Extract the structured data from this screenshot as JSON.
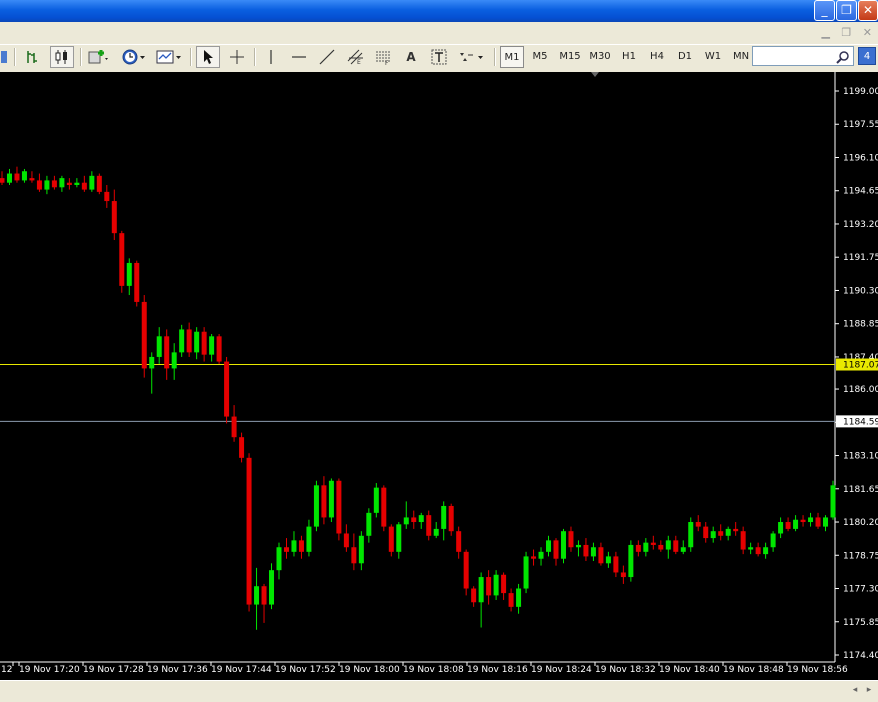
{
  "window": {
    "minimize_label": "_",
    "restore_label": "❐",
    "close_label": "✕"
  },
  "toolbar": {
    "timeframes": [
      {
        "label": "M1",
        "active": true
      },
      {
        "label": "M5",
        "active": false
      },
      {
        "label": "M15",
        "active": false
      },
      {
        "label": "M30",
        "active": false
      },
      {
        "label": "H1",
        "active": false
      },
      {
        "label": "H4",
        "active": false
      },
      {
        "label": "D1",
        "active": false
      },
      {
        "label": "W1",
        "active": false
      },
      {
        "label": "MN",
        "active": false
      }
    ],
    "text_tool_label": "A",
    "search_placeholder": "",
    "tabs_count_badge": "4"
  },
  "colors": {
    "background": "#000000",
    "bull": "#00E600",
    "bear": "#E60000",
    "price_line": "#E8E800",
    "level_line": "#8C9BAF"
  },
  "chart_data": {
    "type": "candlestick",
    "price_axis": {
      "ticks": [
        1199.0,
        1197.55,
        1196.1,
        1194.65,
        1193.2,
        1191.75,
        1190.3,
        1188.85,
        1187.4,
        1186.0,
        1184.55,
        1183.1,
        1181.65,
        1180.2,
        1178.75,
        1177.3,
        1175.85,
        1174.4
      ],
      "current_price": "1187.07",
      "level_label": "1184.59"
    },
    "time_axis": [
      "12",
      "19 Nov 17:20",
      "19 Nov 17:28",
      "19 Nov 17:36",
      "19 Nov 17:44",
      "19 Nov 17:52",
      "19 Nov 18:00",
      "19 Nov 18:08",
      "19 Nov 18:16",
      "19 Nov 18:24",
      "19 Nov 18:32",
      "19 Nov 18:40",
      "19 Nov 18:48",
      "19 Nov 18:56"
    ],
    "candles_ohlc": [
      [
        1195.2,
        1195.5,
        1194.9,
        1195.0
      ],
      [
        1195.0,
        1195.6,
        1194.9,
        1195.4
      ],
      [
        1195.4,
        1195.7,
        1195.0,
        1195.1
      ],
      [
        1195.1,
        1195.6,
        1195.0,
        1195.5
      ],
      [
        1195.2,
        1195.5,
        1195.0,
        1195.1
      ],
      [
        1195.1,
        1195.4,
        1194.6,
        1194.7
      ],
      [
        1194.7,
        1195.3,
        1194.5,
        1195.1
      ],
      [
        1195.1,
        1195.3,
        1194.7,
        1194.8
      ],
      [
        1194.8,
        1195.3,
        1194.6,
        1195.2
      ],
      [
        1195.0,
        1195.2,
        1194.7,
        1194.9
      ],
      [
        1194.9,
        1195.2,
        1194.8,
        1195.0
      ],
      [
        1195.0,
        1195.3,
        1194.6,
        1194.7
      ],
      [
        1194.7,
        1195.5,
        1194.6,
        1195.3
      ],
      [
        1195.3,
        1195.4,
        1194.5,
        1194.6
      ],
      [
        1194.6,
        1194.9,
        1193.9,
        1194.2
      ],
      [
        1194.2,
        1194.7,
        1192.5,
        1192.8
      ],
      [
        1192.8,
        1192.9,
        1190.2,
        1190.5
      ],
      [
        1190.5,
        1191.7,
        1190.1,
        1191.5
      ],
      [
        1191.5,
        1191.6,
        1189.6,
        1189.8
      ],
      [
        1189.8,
        1190.1,
        1186.5,
        1186.9
      ],
      [
        1186.9,
        1187.6,
        1185.8,
        1187.4
      ],
      [
        1187.4,
        1188.7,
        1187.1,
        1188.3
      ],
      [
        1188.3,
        1188.6,
        1186.4,
        1186.9
      ],
      [
        1186.9,
        1188.0,
        1186.4,
        1187.6
      ],
      [
        1187.6,
        1188.8,
        1187.4,
        1188.6
      ],
      [
        1188.6,
        1188.9,
        1187.4,
        1187.6
      ],
      [
        1187.6,
        1188.7,
        1187.3,
        1188.5
      ],
      [
        1188.5,
        1188.7,
        1187.2,
        1187.5
      ],
      [
        1187.5,
        1188.4,
        1187.2,
        1188.3
      ],
      [
        1188.3,
        1188.4,
        1187.1,
        1187.2
      ],
      [
        1187.2,
        1187.4,
        1184.5,
        1184.8
      ],
      [
        1184.8,
        1185.3,
        1183.7,
        1183.9
      ],
      [
        1183.9,
        1184.1,
        1182.8,
        1183.0
      ],
      [
        1183.0,
        1183.2,
        1176.3,
        1176.6
      ],
      [
        1176.6,
        1178.2,
        1175.5,
        1177.4
      ],
      [
        1177.4,
        1177.5,
        1175.8,
        1176.6
      ],
      [
        1176.6,
        1178.4,
        1176.4,
        1178.1
      ],
      [
        1178.1,
        1179.3,
        1177.7,
        1179.1
      ],
      [
        1179.1,
        1179.5,
        1178.6,
        1178.9
      ],
      [
        1178.9,
        1179.8,
        1178.7,
        1179.4
      ],
      [
        1179.4,
        1179.6,
        1178.6,
        1178.9
      ],
      [
        1178.9,
        1180.3,
        1178.7,
        1180.0
      ],
      [
        1180.0,
        1182.0,
        1179.8,
        1181.8
      ],
      [
        1181.8,
        1182.2,
        1180.1,
        1180.4
      ],
      [
        1180.4,
        1182.1,
        1180.2,
        1182.0
      ],
      [
        1182.0,
        1182.1,
        1179.4,
        1179.7
      ],
      [
        1179.7,
        1180.1,
        1178.9,
        1179.1
      ],
      [
        1179.1,
        1179.7,
        1178.1,
        1178.4
      ],
      [
        1178.4,
        1179.8,
        1178.1,
        1179.6
      ],
      [
        1179.6,
        1180.8,
        1179.3,
        1180.6
      ],
      [
        1180.6,
        1181.9,
        1180.4,
        1181.7
      ],
      [
        1181.7,
        1181.8,
        1179.8,
        1180.0
      ],
      [
        1180.0,
        1180.1,
        1178.7,
        1178.9
      ],
      [
        1178.9,
        1180.2,
        1178.6,
        1180.1
      ],
      [
        1180.1,
        1181.1,
        1179.9,
        1180.4
      ],
      [
        1180.4,
        1180.7,
        1179.9,
        1180.2
      ],
      [
        1180.2,
        1180.6,
        1179.9,
        1180.5
      ],
      [
        1180.5,
        1180.7,
        1179.4,
        1179.6
      ],
      [
        1179.6,
        1180.2,
        1179.5,
        1179.9
      ],
      [
        1179.9,
        1181.1,
        1179.4,
        1180.9
      ],
      [
        1180.9,
        1181.0,
        1179.6,
        1179.8
      ],
      [
        1179.8,
        1180.0,
        1178.6,
        1178.9
      ],
      [
        1178.9,
        1179.0,
        1177.0,
        1177.3
      ],
      [
        1177.3,
        1177.4,
        1176.5,
        1176.7
      ],
      [
        1176.7,
        1178.0,
        1175.6,
        1177.8
      ],
      [
        1177.8,
        1178.1,
        1176.6,
        1177.0
      ],
      [
        1177.0,
        1178.1,
        1176.8,
        1177.9
      ],
      [
        1177.9,
        1178.0,
        1176.8,
        1177.1
      ],
      [
        1177.1,
        1177.3,
        1176.3,
        1176.5
      ],
      [
        1176.5,
        1177.5,
        1176.2,
        1177.3
      ],
      [
        1177.3,
        1178.9,
        1177.1,
        1178.7
      ],
      [
        1178.7,
        1179.0,
        1178.3,
        1178.6
      ],
      [
        1178.6,
        1179.1,
        1178.3,
        1178.9
      ],
      [
        1178.9,
        1179.6,
        1178.7,
        1179.4
      ],
      [
        1179.4,
        1179.5,
        1178.3,
        1178.6
      ],
      [
        1178.6,
        1179.9,
        1178.4,
        1179.8
      ],
      [
        1179.8,
        1180.0,
        1178.9,
        1179.1
      ],
      [
        1179.1,
        1179.4,
        1178.7,
        1179.2
      ],
      [
        1179.2,
        1179.5,
        1178.5,
        1178.7
      ],
      [
        1178.7,
        1179.3,
        1178.5,
        1179.1
      ],
      [
        1179.1,
        1179.3,
        1178.3,
        1178.4
      ],
      [
        1178.4,
        1178.9,
        1178.2,
        1178.7
      ],
      [
        1178.7,
        1178.9,
        1177.8,
        1178.0
      ],
      [
        1178.0,
        1178.3,
        1177.5,
        1177.8
      ],
      [
        1177.8,
        1179.4,
        1177.6,
        1179.2
      ],
      [
        1179.2,
        1179.4,
        1178.7,
        1178.9
      ],
      [
        1178.9,
        1179.5,
        1178.7,
        1179.3
      ],
      [
        1179.3,
        1179.6,
        1179.0,
        1179.2
      ],
      [
        1179.2,
        1179.4,
        1178.9,
        1179.0
      ],
      [
        1179.0,
        1179.6,
        1178.6,
        1179.4
      ],
      [
        1179.4,
        1179.6,
        1178.8,
        1178.9
      ],
      [
        1178.9,
        1179.4,
        1178.8,
        1179.1
      ],
      [
        1179.1,
        1180.4,
        1178.9,
        1180.2
      ],
      [
        1180.2,
        1180.5,
        1179.8,
        1180.0
      ],
      [
        1180.0,
        1180.2,
        1179.3,
        1179.5
      ],
      [
        1179.5,
        1180.0,
        1179.3,
        1179.8
      ],
      [
        1179.8,
        1180.1,
        1179.4,
        1179.6
      ],
      [
        1179.6,
        1180.0,
        1179.4,
        1179.9
      ],
      [
        1179.9,
        1180.2,
        1179.6,
        1179.8
      ],
      [
        1179.8,
        1180.0,
        1178.8,
        1179.0
      ],
      [
        1179.0,
        1179.3,
        1178.8,
        1179.1
      ],
      [
        1179.1,
        1179.3,
        1178.7,
        1178.8
      ],
      [
        1178.8,
        1179.3,
        1178.6,
        1179.1
      ],
      [
        1179.1,
        1179.8,
        1178.9,
        1179.7
      ],
      [
        1179.7,
        1180.4,
        1179.5,
        1180.2
      ],
      [
        1180.2,
        1180.4,
        1179.8,
        1179.9
      ],
      [
        1179.9,
        1180.5,
        1179.8,
        1180.3
      ],
      [
        1180.3,
        1180.5,
        1180.0,
        1180.2
      ],
      [
        1180.2,
        1180.6,
        1180.0,
        1180.4
      ],
      [
        1180.4,
        1180.6,
        1179.9,
        1180.0
      ],
      [
        1180.0,
        1180.5,
        1179.8,
        1180.4
      ],
      [
        1180.4,
        1182.0,
        1180.3,
        1181.8
      ]
    ]
  }
}
